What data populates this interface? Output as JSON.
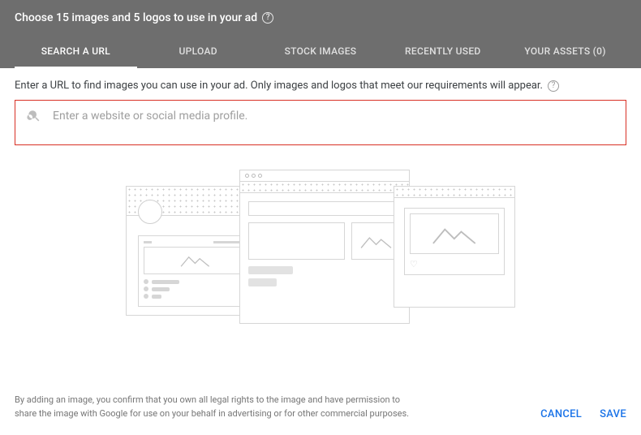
{
  "header": {
    "title": "Choose 15 images and 5 logos to use in your ad",
    "tabs": [
      {
        "label": "SEARCH A URL",
        "active": true
      },
      {
        "label": "UPLOAD"
      },
      {
        "label": "STOCK IMAGES"
      },
      {
        "label": "RECENTLY USED"
      },
      {
        "label": "YOUR ASSETS (0)"
      }
    ]
  },
  "content": {
    "instruction": "Enter a URL to find images you can use in your ad. Only images and logos that meet our requirements will appear.",
    "search_placeholder": "Enter a website or social media profile."
  },
  "footer": {
    "disclaimer": "By adding an image, you confirm that you own all legal rights to the image and have permission to share the image with Google for use on your behalf in advertising or for other commercial purposes.",
    "cancel_label": "CANCEL",
    "save_label": "SAVE"
  }
}
